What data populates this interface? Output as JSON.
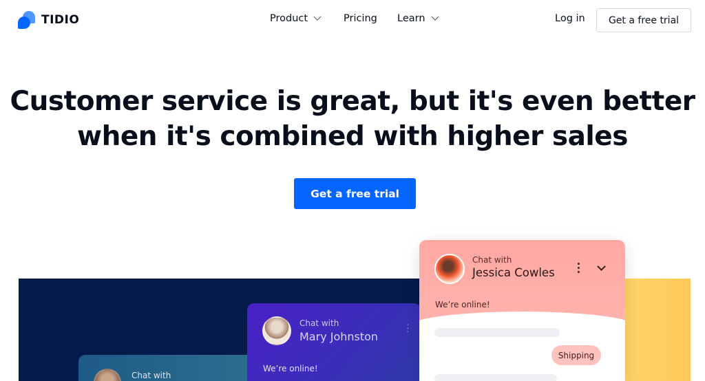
{
  "brand": {
    "name": "TIDIO",
    "primary": "#0566ff"
  },
  "nav": {
    "items": [
      {
        "label": "Product",
        "has_dropdown": true
      },
      {
        "label": "Pricing",
        "has_dropdown": false
      },
      {
        "label": "Learn",
        "has_dropdown": true
      }
    ],
    "login": "Log in",
    "trial": "Get a free trial"
  },
  "hero": {
    "title_part1": "Customer service is great, but it's ",
    "title_bold": "even better",
    "title_part2": " when it's combined with higher sales",
    "cta": "Get a free trial"
  },
  "chats": {
    "teal": {
      "chat_with": "Chat with"
    },
    "purple": {
      "chat_with": "Chat with",
      "name": "Mary Johnston",
      "status": "We’re online!"
    },
    "pink": {
      "chat_with": "Chat with",
      "name": "Jessica Cowles",
      "status": "We’re online!",
      "tag": "Shipping"
    }
  }
}
